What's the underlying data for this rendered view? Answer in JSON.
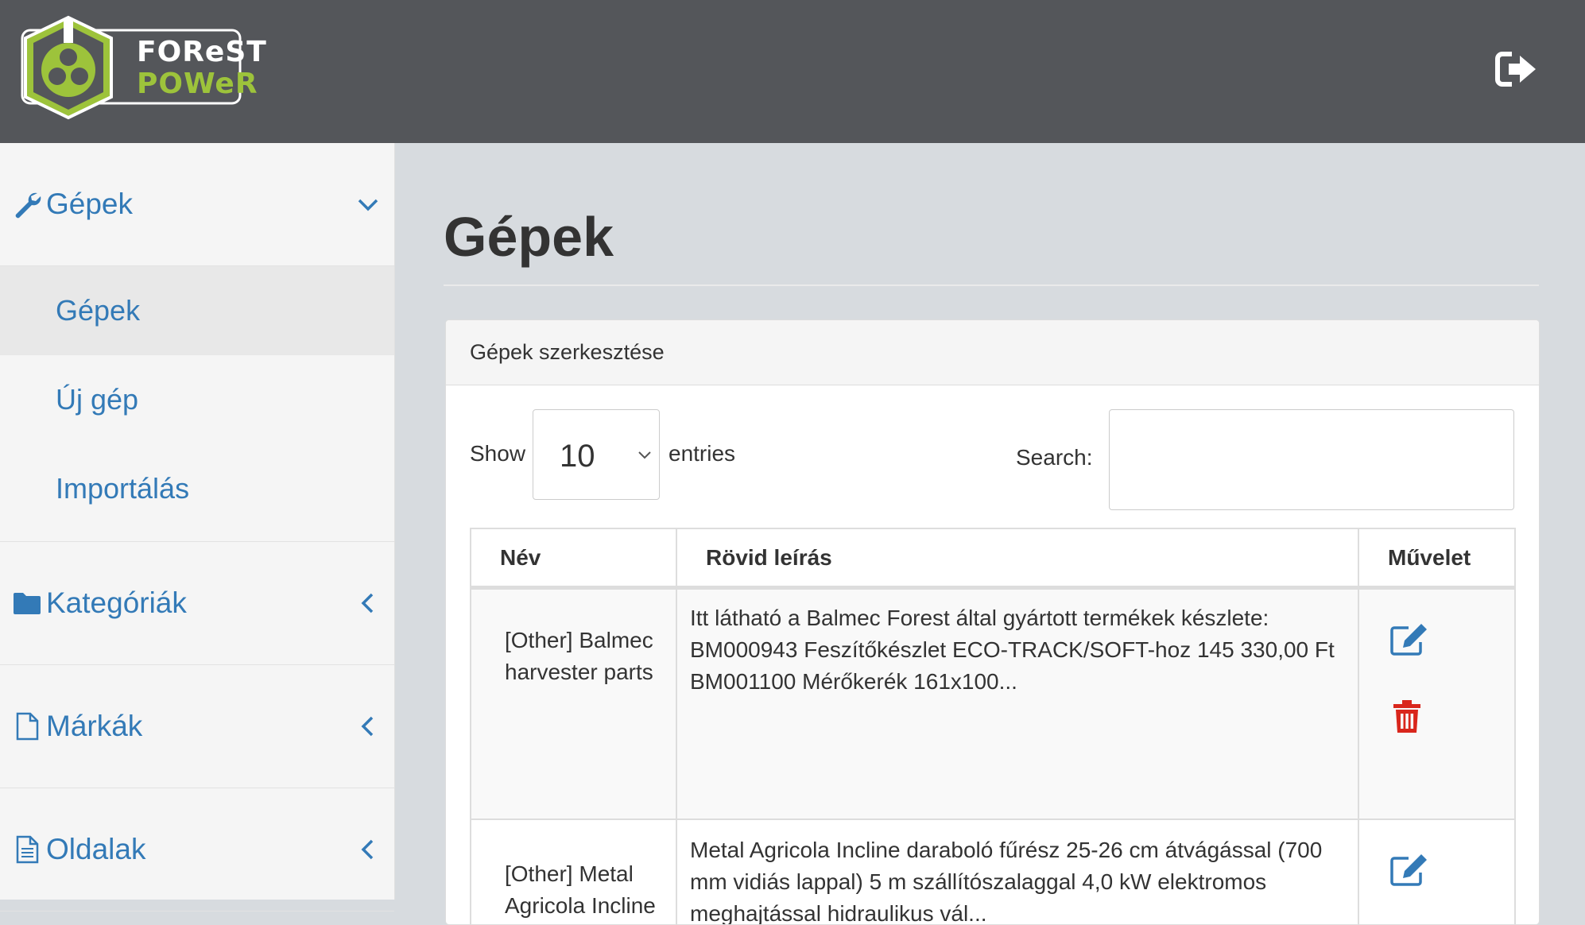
{
  "header": {
    "logo_line1": "FOReST",
    "logo_line2": "POWeR",
    "logout_icon": "sign-out-icon"
  },
  "sidebar": {
    "groups": [
      {
        "label": "Gépek",
        "icon": "wrench-icon",
        "expanded": true,
        "items": [
          {
            "label": "Gépek",
            "active": true
          },
          {
            "label": "Új gép"
          },
          {
            "label": "Importálás"
          }
        ]
      },
      {
        "label": "Kategóriák",
        "icon": "folder-icon"
      },
      {
        "label": "Márkák",
        "icon": "file-icon"
      },
      {
        "label": "Oldalak",
        "icon": "file-text-icon"
      }
    ]
  },
  "main": {
    "title": "Gépek",
    "panel_title": "Gépek szerkesztése",
    "show_label": "Show",
    "entries_value": "10",
    "entries_label": "entries",
    "search_label": "Search:",
    "search_value": "",
    "columns": [
      "Név",
      "Rövid leírás",
      "Művelet"
    ],
    "rows": [
      {
        "name": "[Other] Balmec harvester parts",
        "description": "Itt látható a Balmec Forest által gyártott termékek készlete: BM000943 Feszítőkészlet ECO-TRACK/SOFT-hoz 145 330,00 Ft BM001100 Mérőkerék 161x100..."
      },
      {
        "name": "[Other] Metal Agricola Incline",
        "description": "Metal Agricola Incline daraboló fűrész 25-26 cm átvágással (700 mm vidiás lappal) 5 m szállítószalaggal 4,0 kW elektromos meghajtással hidraulikus vál..."
      }
    ],
    "colors": {
      "link": "#337ab7",
      "delete": "#d9261c",
      "header_bg": "#54565a",
      "logo_green": "#9dc33b"
    }
  }
}
